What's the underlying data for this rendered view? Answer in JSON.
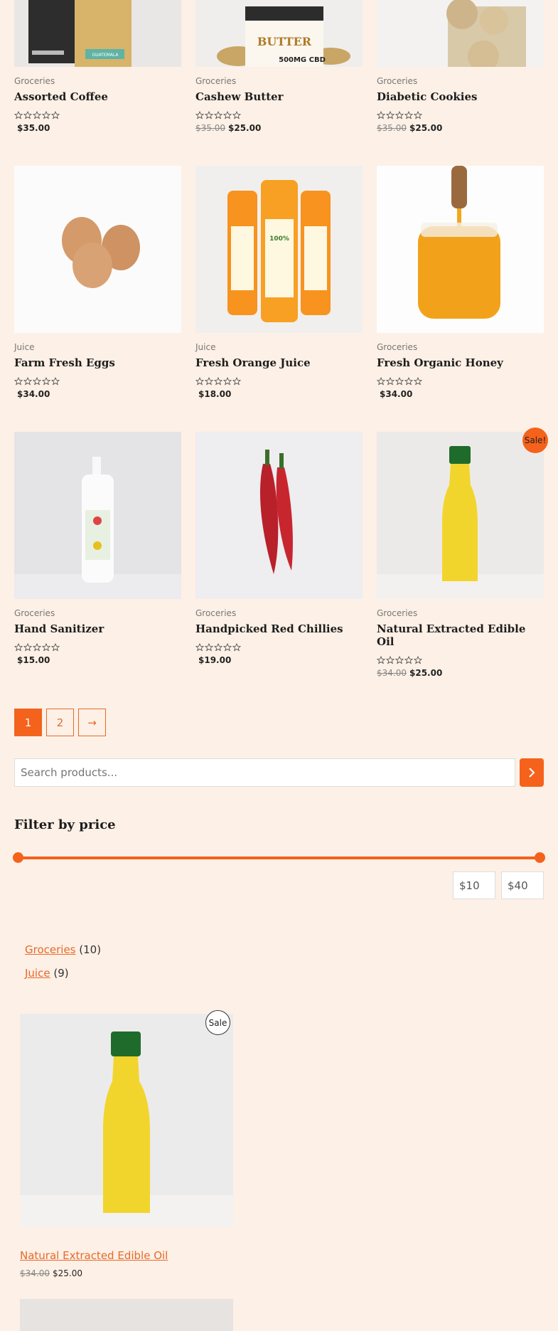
{
  "products": [
    {
      "category": "Groceries",
      "title": "Assorted Coffee",
      "old_price": "",
      "price": "$35.00",
      "rating": 0
    },
    {
      "category": "Groceries",
      "title": "Cashew Butter",
      "old_price": "$35.00",
      "price": "$25.00",
      "rating": 0
    },
    {
      "category": "Groceries",
      "title": "Diabetic Cookies",
      "old_price": "$35.00",
      "price": "$25.00",
      "rating": 0
    },
    {
      "category": "Juice",
      "title": "Farm Fresh Eggs",
      "old_price": "",
      "price": "$34.00",
      "rating": 0
    },
    {
      "category": "Juice",
      "title": "Fresh Orange Juice",
      "old_price": "",
      "price": "$18.00",
      "rating": 0
    },
    {
      "category": "Groceries",
      "title": "Fresh Organic Honey",
      "old_price": "",
      "price": "$34.00",
      "rating": 0
    },
    {
      "category": "Groceries",
      "title": "Hand Sanitizer",
      "old_price": "",
      "price": "$15.00",
      "rating": 0
    },
    {
      "category": "Groceries",
      "title": "Handpicked Red Chillies",
      "old_price": "",
      "price": "$19.00",
      "rating": 0
    },
    {
      "category": "Groceries",
      "title": "Natural Extracted Edible Oil",
      "old_price": "$34.00",
      "price": "$25.00",
      "rating": 0,
      "badge": "Sale!"
    }
  ],
  "product_images": {
    "butter_jar_text": "BUTTER",
    "butter_jar_subtext": "500MG CBD",
    "coffee_bag_text": "GUATEMALA",
    "juice_label": "100%"
  },
  "pagination": {
    "pages": [
      "1",
      "2"
    ],
    "next": "→",
    "current": "1"
  },
  "search": {
    "placeholder": "Search products..."
  },
  "filter": {
    "title": "Filter by price",
    "min": "$10",
    "max": "$40",
    "range_min": 10,
    "range_max": 40
  },
  "categories": [
    {
      "name": "Groceries",
      "count": "(10)"
    },
    {
      "name": "Juice",
      "count": "(9)"
    }
  ],
  "sidebar_product": {
    "badge": "Sale",
    "title": "Natural Extracted Edible Oil",
    "old_price": "$34.00",
    "price": "$25.00"
  },
  "colors": {
    "accent": "#f4621c",
    "link": "#e66a2a",
    "background": "#fdf0e6"
  }
}
